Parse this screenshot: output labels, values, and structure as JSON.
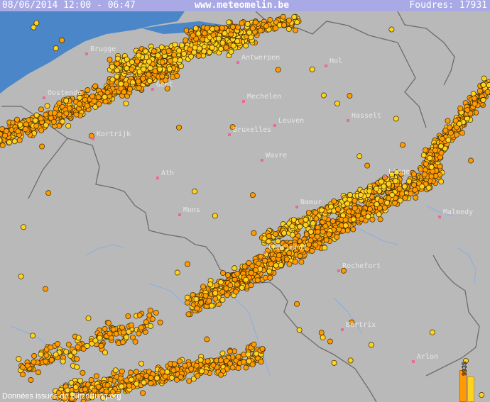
{
  "header": {
    "datetime": "08/06/2014 12:00 - 06:47",
    "site": "www.meteomelin.be",
    "strikes_label": "Foudres: 17931"
  },
  "cities": [
    {
      "name": "Brugge"
    },
    {
      "name": "Antwerpen"
    },
    {
      "name": "Hol"
    },
    {
      "name": "Oostende"
    },
    {
      "name": "Gent"
    },
    {
      "name": "Mechelen"
    },
    {
      "name": "Hasselt"
    },
    {
      "name": "Leuven"
    },
    {
      "name": "Kortrijk"
    },
    {
      "name": "Bruxelles"
    },
    {
      "name": "Wavre"
    },
    {
      "name": "Liege"
    },
    {
      "name": "Ath"
    },
    {
      "name": "Namur"
    },
    {
      "name": "Mons"
    },
    {
      "name": "Malmedy"
    },
    {
      "name": "Charleroi"
    },
    {
      "name": "Rochefort"
    },
    {
      "name": "Bertrix"
    },
    {
      "name": "Arlon"
    }
  ],
  "legend": {
    "count": "9935",
    "colors": [
      "#ff9a00",
      "#ffd21e"
    ]
  },
  "credit": "Données issues de Blitzortung.org",
  "colors": {
    "land": "#b9b9b9",
    "sea": "#4a86c8",
    "header_bar": "#a9a9e6",
    "strike_old": "#ff9a00",
    "strike_new": "#ffd21e"
  }
}
